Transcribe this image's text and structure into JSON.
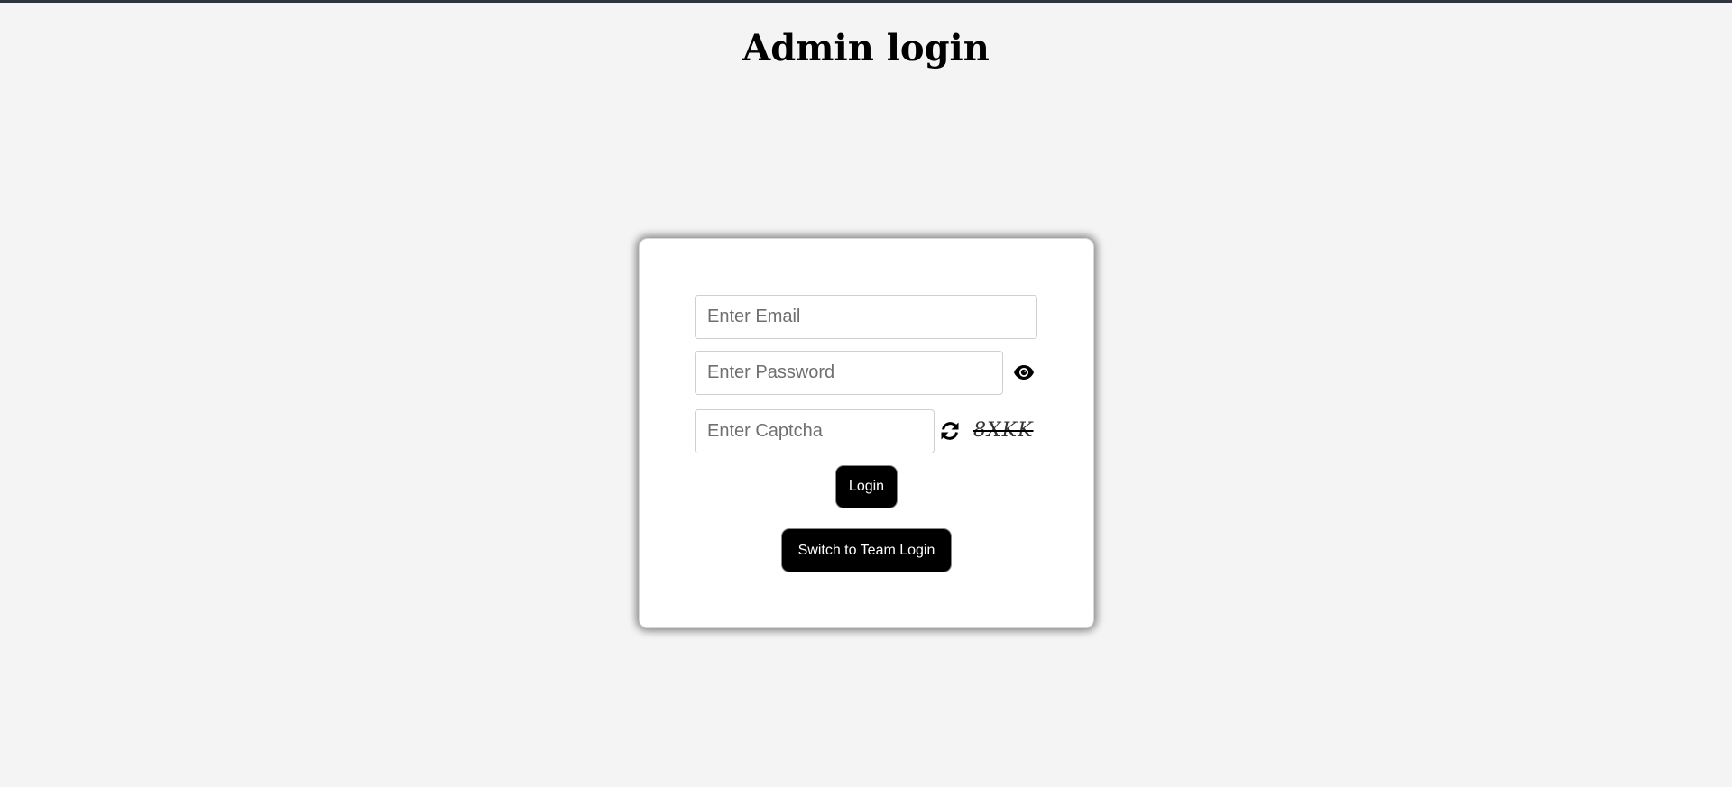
{
  "page": {
    "title": "Admin login"
  },
  "form": {
    "email_placeholder": "Enter Email",
    "email_value": "",
    "password_placeholder": "Enter Password",
    "password_value": "",
    "captcha_placeholder": "Enter Captcha",
    "captcha_value": "",
    "captcha_code": "8XKK",
    "login_label": "Login",
    "switch_label": "Switch to Team Login"
  },
  "icons": {
    "password_toggle": "eye-icon",
    "captcha_refresh": "refresh-icon"
  },
  "colors": {
    "background": "#f4f4f4",
    "card": "#ffffff",
    "button": "#000000",
    "button_text": "#ffffff"
  }
}
